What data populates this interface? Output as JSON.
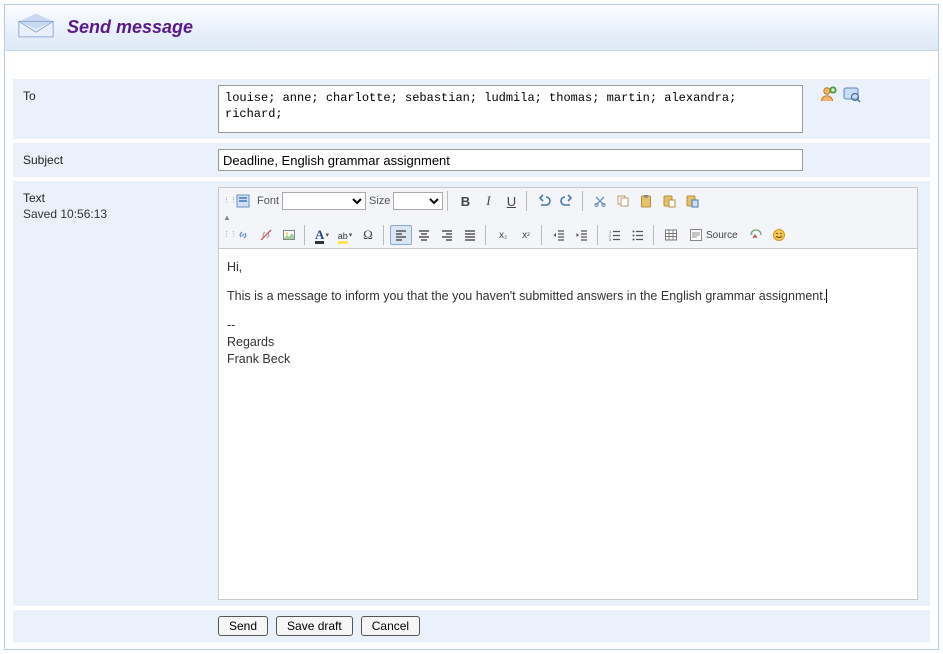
{
  "header": {
    "title": "Send message"
  },
  "labels": {
    "to": "To",
    "subject": "Subject",
    "text": "Text",
    "saved": "Saved 10:56:13"
  },
  "fields": {
    "to_value": "louise; anne; charlotte; sebastian; ludmila; thomas; martin; alexandra; richard;",
    "subject_value": "Deadline, English grammar assignment"
  },
  "editor": {
    "font_label": "Font",
    "size_label": "Size",
    "font_value": "",
    "size_value": "",
    "source_label": "Source",
    "body_greeting": "Hi,",
    "body_para1": "This is a message to inform you that the you haven't submitted answers in the English grammar assignment.",
    "body_sigsep": "--",
    "body_sig1": "Regards",
    "body_sig2": "Frank Beck"
  },
  "footer": {
    "send": "Send",
    "save_draft": "Save draft",
    "cancel": "Cancel"
  }
}
